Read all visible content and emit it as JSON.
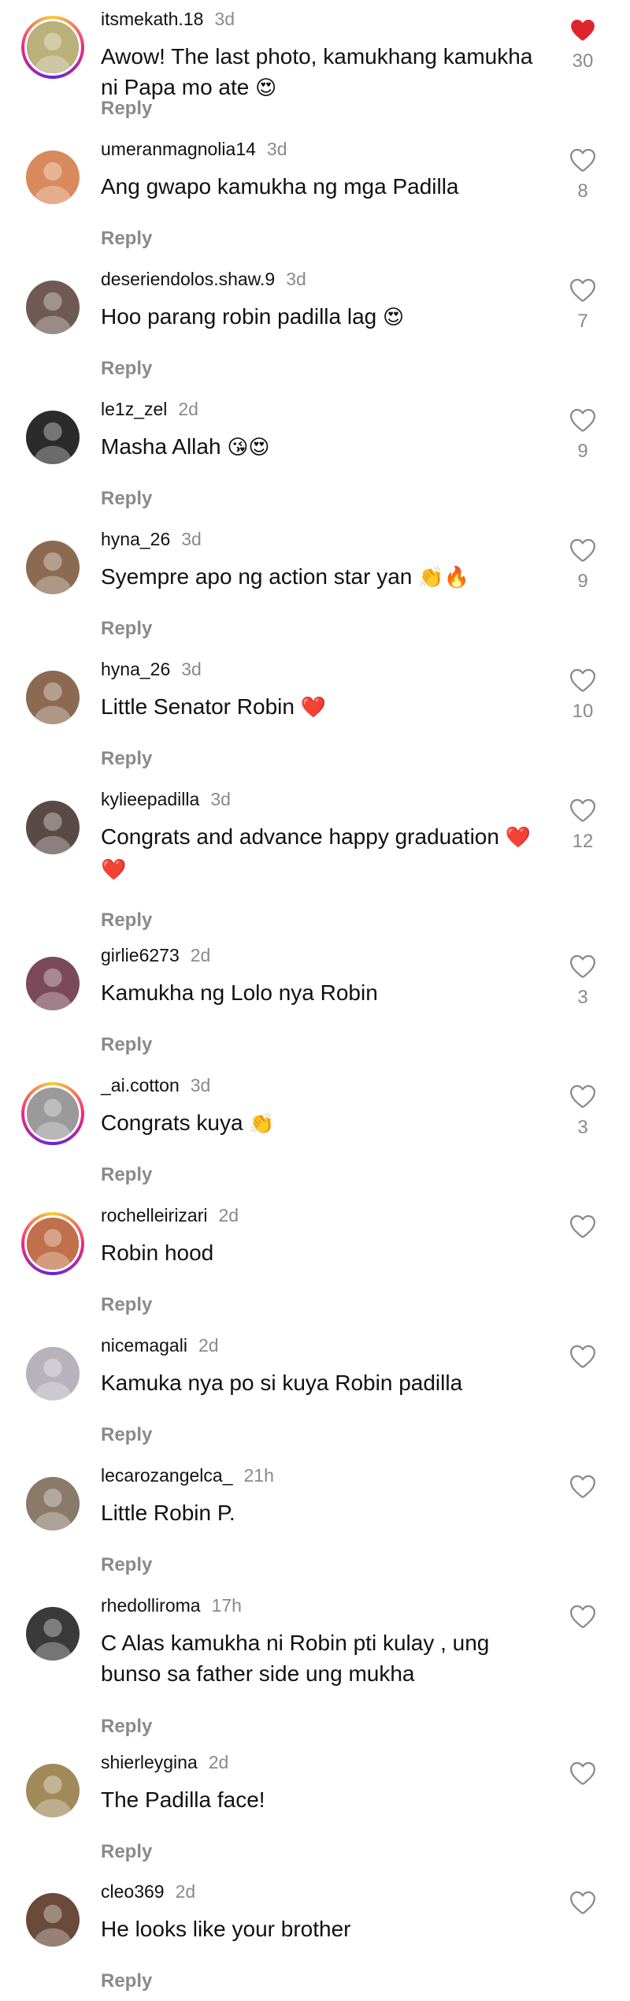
{
  "comments": [
    {
      "username": "itsmekath.18",
      "time": "3d",
      "text": "Awow! The last photo, kamukhang kamukha ni Papa mo ate",
      "emoji": "😍",
      "reply": "Reply",
      "likes": "30",
      "liked": true,
      "ring": true,
      "avatar_color": "#b9b07a"
    },
    {
      "username": "umeranmagnolia14",
      "time": "3d",
      "text": "Ang gwapo kamukha ng mga Padilla",
      "emoji": "",
      "reply": "Reply",
      "likes": "8",
      "liked": false,
      "ring": false,
      "avatar_color": "#d98a5c"
    },
    {
      "username": "deseriendolos.shaw.9",
      "time": "3d",
      "text": "Hoo parang robin padilla lag",
      "emoji": "😍",
      "reply": "Reply",
      "likes": "7",
      "liked": false,
      "ring": false,
      "avatar_color": "#6e5a52"
    },
    {
      "username": "le1z_zel",
      "time": "2d",
      "text": "Masha Allah",
      "emoji": "😘😍",
      "reply": "Reply",
      "likes": "9",
      "liked": false,
      "ring": false,
      "avatar_color": "#2b2b2b"
    },
    {
      "username": "hyna_26",
      "time": "3d",
      "text": "Syempre apo ng action star yan",
      "emoji": "👏🔥",
      "reply": "Reply",
      "likes": "9",
      "liked": false,
      "ring": false,
      "avatar_color": "#8c6a52"
    },
    {
      "username": "hyna_26",
      "time": "3d",
      "text": "Little Senator Robin",
      "emoji": "❤️",
      "reply": "Reply",
      "likes": "10",
      "liked": false,
      "ring": false,
      "avatar_color": "#8c6a52"
    },
    {
      "username": "kylieepadilla",
      "time": "3d",
      "text": "Congrats and advance happy graduation",
      "emoji": "❤️❤️",
      "reply": "Reply",
      "likes": "12",
      "liked": false,
      "ring": false,
      "avatar_color": "#5a4a46"
    },
    {
      "username": "girlie6273",
      "time": "2d",
      "text": "Kamukha ng Lolo nya Robin",
      "emoji": "",
      "reply": "Reply",
      "likes": "3",
      "liked": false,
      "ring": false,
      "avatar_color": "#7a4a5a"
    },
    {
      "username": "_ai.cotton",
      "time": "3d",
      "text": "Congrats kuya",
      "emoji": "👏",
      "reply": "Reply",
      "likes": "3",
      "liked": false,
      "ring": true,
      "avatar_color": "#9a9a9a"
    },
    {
      "username": "rochelleirizari",
      "time": "2d",
      "text": "Robin hood",
      "emoji": "",
      "reply": "Reply",
      "likes": "",
      "liked": false,
      "ring": true,
      "avatar_color": "#c0704a"
    },
    {
      "username": "nicemagali",
      "time": "2d",
      "text": "Kamuka nya po si kuya Robin padilla",
      "emoji": "",
      "reply": "Reply",
      "likes": "",
      "liked": false,
      "ring": false,
      "avatar_color": "#b8b2bc"
    },
    {
      "username": "lecarozangelca_",
      "time": "21h",
      "text": "Little Robin P.",
      "emoji": "",
      "reply": "Reply",
      "likes": "",
      "liked": false,
      "ring": false,
      "avatar_color": "#8a7a6a"
    },
    {
      "username": "rhedolliroma",
      "time": "17h",
      "text": "C Alas  kamukha ni Robin pti kulay , ung bunso sa father side ung mukha",
      "emoji": "",
      "reply": "Reply",
      "likes": "",
      "liked": false,
      "ring": false,
      "avatar_color": "#3a3a3a"
    },
    {
      "username": "shierleygina",
      "time": "2d",
      "text": "The Padilla face!",
      "emoji": "",
      "reply": "Reply",
      "likes": "",
      "liked": false,
      "ring": false,
      "avatar_color": "#a08a5a"
    },
    {
      "username": "cleo369",
      "time": "2d",
      "text": "He looks like your brother",
      "emoji": "",
      "reply": "Reply",
      "likes": "",
      "liked": false,
      "ring": false,
      "avatar_color": "#6a4a3a"
    }
  ],
  "colors": {
    "heart_liked": "#e0242e",
    "heart_outline": "#8a8a8a",
    "secondary_text": "#8a8a8a",
    "primary_text": "#111111",
    "background": "#ffffff"
  },
  "icons": {
    "like": "heart-icon"
  }
}
